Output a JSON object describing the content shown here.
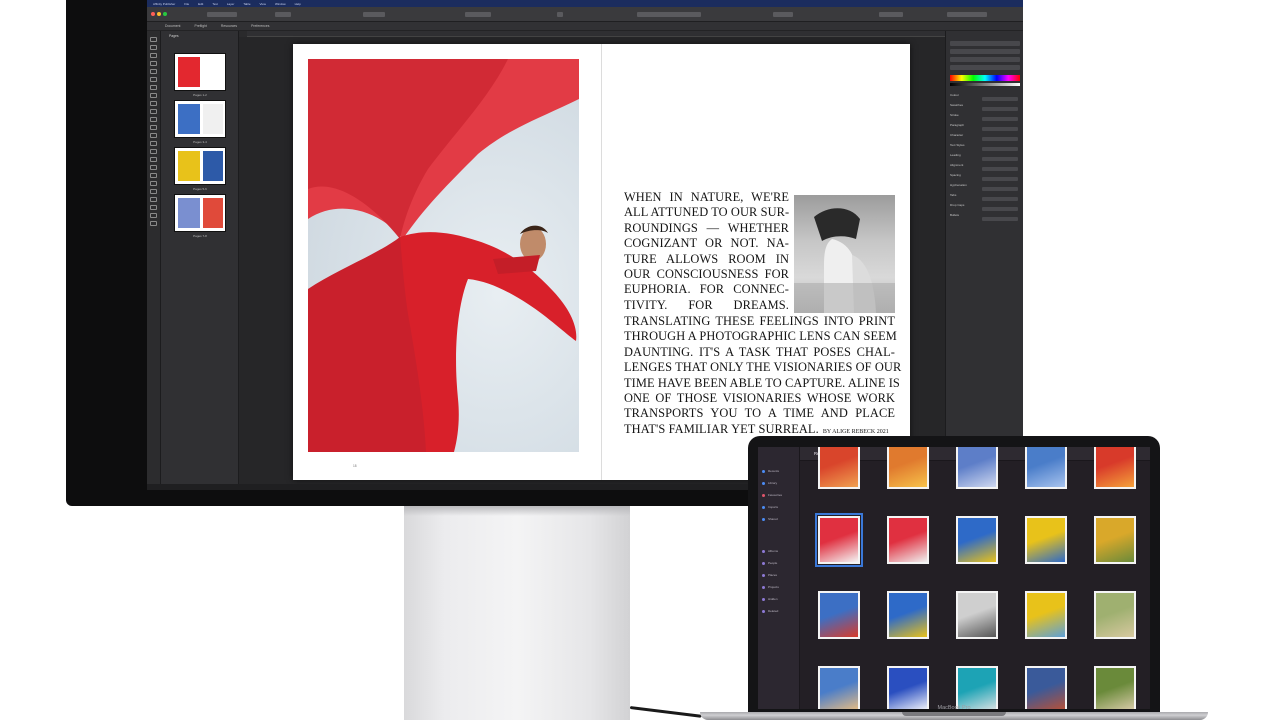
{
  "affinity": {
    "menubar": [
      "Affinity Publisher",
      "File",
      "Edit",
      "Text",
      "Layer",
      "Table",
      "View",
      "Window",
      "Help"
    ],
    "tabs": [
      "Document",
      "Preflight",
      "Resources",
      "Preferences"
    ],
    "pages_panel": {
      "title": "Pages",
      "thumbs": [
        {
          "caption": "Pages 1-2"
        },
        {
          "caption": "Pages 3-4"
        },
        {
          "caption": "Pages 5-6"
        },
        {
          "caption": "Pages 7-8"
        }
      ]
    },
    "spread": {
      "narrow_lines": [
        "WHEN IN NATURE, WE'RE",
        "ALL ATTUNED TO OUR SUR-",
        "ROUNDINGS — WHETHER",
        "COGNIZANT OR NOT. NA-",
        "TURE ALLOWS ROOM IN",
        "OUR CONSCIOUSNESS FOR",
        "EUPHORIA. FOR CONNEC-",
        "TIVITY. FOR DREAMS."
      ],
      "wide_lines": [
        "TRANSLATING THESE FEELINGS INTO PRINT",
        "THROUGH A PHOTOGRAPHIC LENS CAN SEEM",
        "DAUNTING. IT'S A TASK THAT POSES CHAL-",
        "LENGES THAT ONLY THE VISIONARIES OF OUR",
        "TIME HAVE BEEN ABLE TO CAPTURE. ALINE IS",
        "ONE OF THOSE VISIONARIES WHOSE WORK",
        "TRANSPORTS YOU TO A TIME AND PLACE"
      ],
      "last_line": "THAT'S FAMILIAR YET SURREAL.",
      "byline": "BY ALIGE REBECK 2021",
      "folio": "18"
    },
    "right_panel": {
      "labels": [
        "Colour",
        "Swatches",
        "Stroke",
        "Paragraph",
        "Character",
        "Text Styles",
        "Leading",
        "Alignment",
        "Spacing",
        "Hyphenation",
        "Tabs",
        "Drop Caps",
        "Bullets"
      ]
    }
  },
  "photos": {
    "toolbar_title": "Recents",
    "sidebar": [
      "Recents",
      "Library",
      "Favourites",
      "Imports",
      "Shared",
      "Albums",
      "People",
      "Places",
      "Projects",
      "Hidden",
      "Deleted"
    ],
    "rows": [
      [
        {
          "cap": ""
        },
        {
          "cap": ""
        },
        {
          "cap": ""
        },
        {
          "cap": ""
        },
        {
          "cap": ""
        }
      ],
      [
        {
          "cap": "",
          "selected": true
        },
        {
          "cap": ""
        },
        {
          "cap": ""
        },
        {
          "cap": ""
        },
        {
          "cap": ""
        }
      ],
      [
        {
          "cap": ""
        },
        {
          "cap": ""
        },
        {
          "cap": ""
        },
        {
          "cap": ""
        },
        {
          "cap": ""
        }
      ],
      [
        {
          "cap": ""
        },
        {
          "cap": ""
        },
        {
          "cap": ""
        },
        {
          "cap": ""
        },
        {
          "cap": ""
        }
      ]
    ]
  },
  "colors": {
    "accent_red": "#d81e1e",
    "selection_blue": "#2f6fd4",
    "yellow": "#e8c21a",
    "photos_bg": "#231f25"
  },
  "laptop_label": "MacBook Pro"
}
